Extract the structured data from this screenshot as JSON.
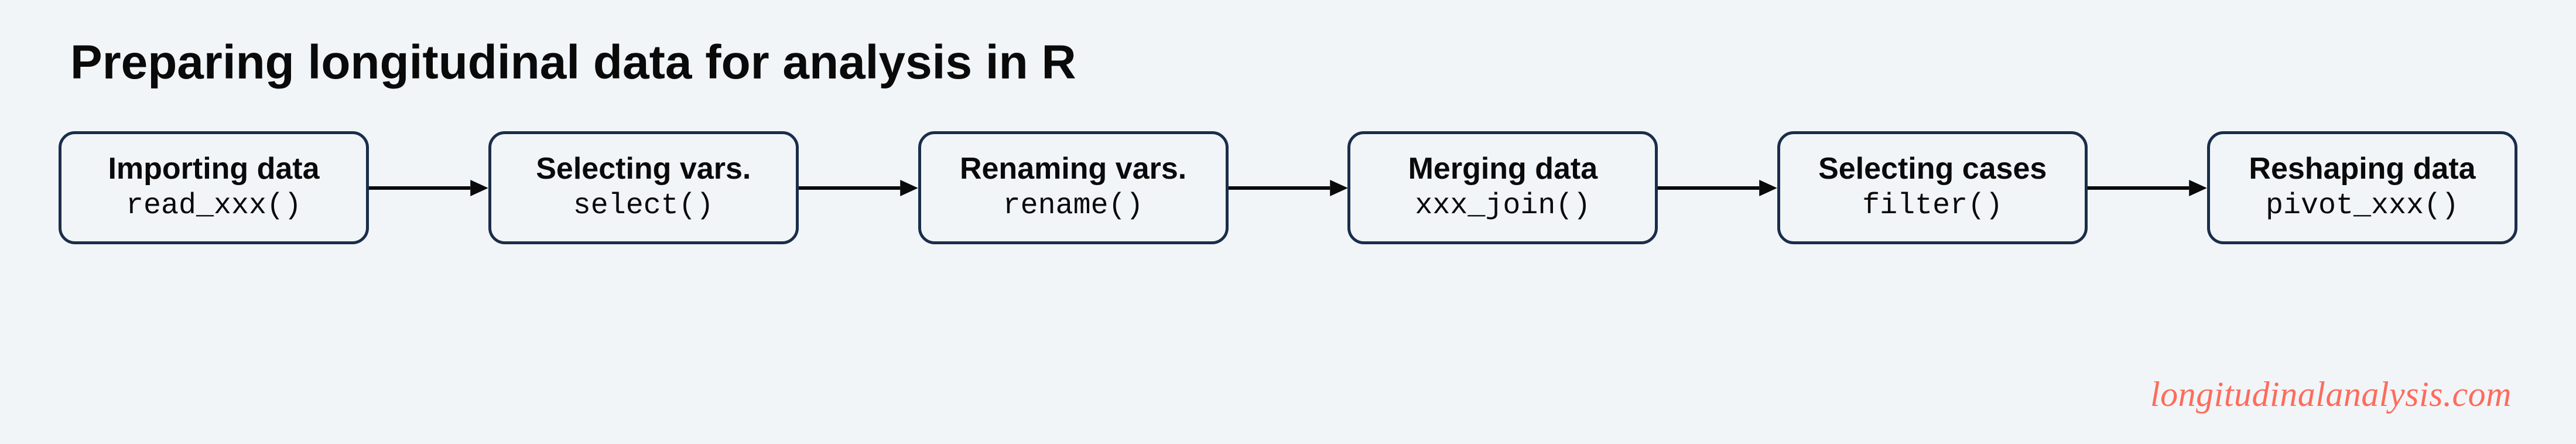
{
  "title": "Preparing longitudinal data for analysis in R",
  "steps": [
    {
      "label": "Importing data",
      "func": "read_xxx()"
    },
    {
      "label": "Selecting vars.",
      "func": "select()"
    },
    {
      "label": "Renaming vars.",
      "func": "rename()"
    },
    {
      "label": "Merging data",
      "func": "xxx_join()"
    },
    {
      "label": "Selecting cases",
      "func": "filter()"
    },
    {
      "label": "Reshaping data",
      "func": "pivot_xxx()"
    }
  ],
  "credit": "longitudinalanalysis.com",
  "colors": {
    "background": "#f1f5f8",
    "border": "#1a2e4a",
    "text": "#0a0a0a",
    "credit": "#ff6b5b"
  }
}
